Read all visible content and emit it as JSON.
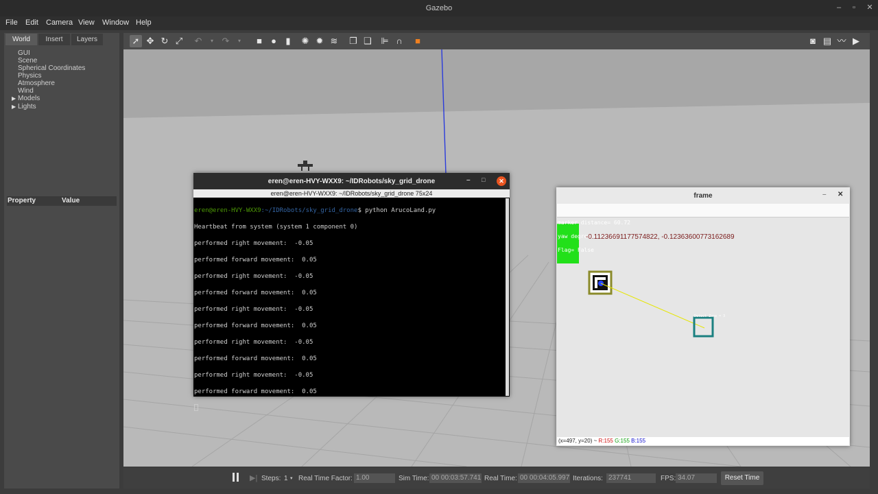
{
  "window": {
    "title": "Gazebo",
    "controls": [
      "–",
      "▫",
      "✕"
    ]
  },
  "menu": [
    "File",
    "Edit",
    "Camera",
    "View",
    "Window",
    "Help"
  ],
  "left_panel": {
    "tabs": [
      "World",
      "Insert",
      "Layers"
    ],
    "tree": [
      "GUI",
      "Scene",
      "Spherical Coordinates",
      "Physics",
      "Atmosphere",
      "Wind",
      "Models",
      "Lights"
    ],
    "property_header": {
      "col1": "Property",
      "col2": "Value"
    }
  },
  "bottom": {
    "steps_label": "Steps:",
    "steps_value": "1",
    "rtf_label": "Real Time Factor:",
    "rtf_value": "1.00",
    "sim_label": "Sim Time:",
    "sim_value": "00 00:03:57.741",
    "real_label": "Real Time:",
    "real_value": "00 00:04:05.997",
    "iter_label": "Iterations:",
    "iter_value": "237741",
    "fps_label": "FPS:",
    "fps_value": "34.07",
    "reset_label": "Reset Time"
  },
  "terminal": {
    "title": "eren@eren-HVY-WXX9: ~/IDRobots/sky_grid_drone",
    "subtitle": "eren@eren-HVY-WXX9: ~/IDRobots/sky_grid_drone 75x24",
    "prompt_user": "eren@eren-HVY-WXX9",
    "prompt_path": ":~/IDRobots/sky_grid_drone",
    "prompt_cmd": "$ python ArucoLand.py",
    "lines": [
      "Heartbeat from system (system 1 component 0)",
      "performed right movement:  -0.05",
      "performed forward movement:  0.05",
      "performed right movement:  -0.05",
      "performed forward movement:  0.05",
      "performed right movement:  -0.05",
      "performed forward movement:  0.05",
      "performed right movement:  -0.05",
      "performed forward movement:  0.05",
      "performed right movement:  -0.05",
      "performed forward movement:  0.05"
    ]
  },
  "frame": {
    "title": "frame",
    "marker_distance": "marker distance= 60.72",
    "yaw_degrees": "yaw degrees= 37.40",
    "flag": "Flag= False",
    "coords": "-0.11236691177574822, -0.1236360077316​2689",
    "detect_zone": "Detect Zone = 3",
    "status_pos": "(x=497, y=20) ~",
    "status_r": "R:155",
    "status_g": "G:155",
    "status_b": "B:155"
  }
}
